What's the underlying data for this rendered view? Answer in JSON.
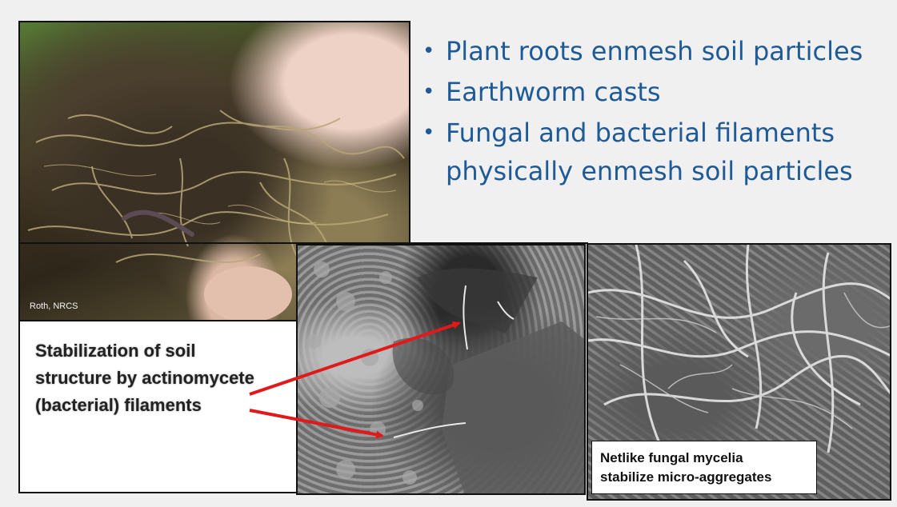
{
  "photo_credit": "Roth, NRCS",
  "bullets": [
    {
      "text": "Plant roots enmesh soil particles"
    },
    {
      "text": "Earthworm casts"
    },
    {
      "text": "Fungal and bacterial filaments physically enmesh soil particles"
    }
  ],
  "caption": {
    "line1": "Stabilization of soil",
    "line2": "structure by actinomycete",
    "line3": "(bacterial) filaments"
  },
  "fungal_label": {
    "line1": "Netlike fungal mycelia",
    "line2": "stabilize micro-aggregates"
  },
  "colors": {
    "bullet_text": "#1e5a96",
    "arrow": "#e01a1a"
  },
  "icons": {
    "bullet": "bullet-dot-icon",
    "arrow": "red-arrow-icon"
  }
}
